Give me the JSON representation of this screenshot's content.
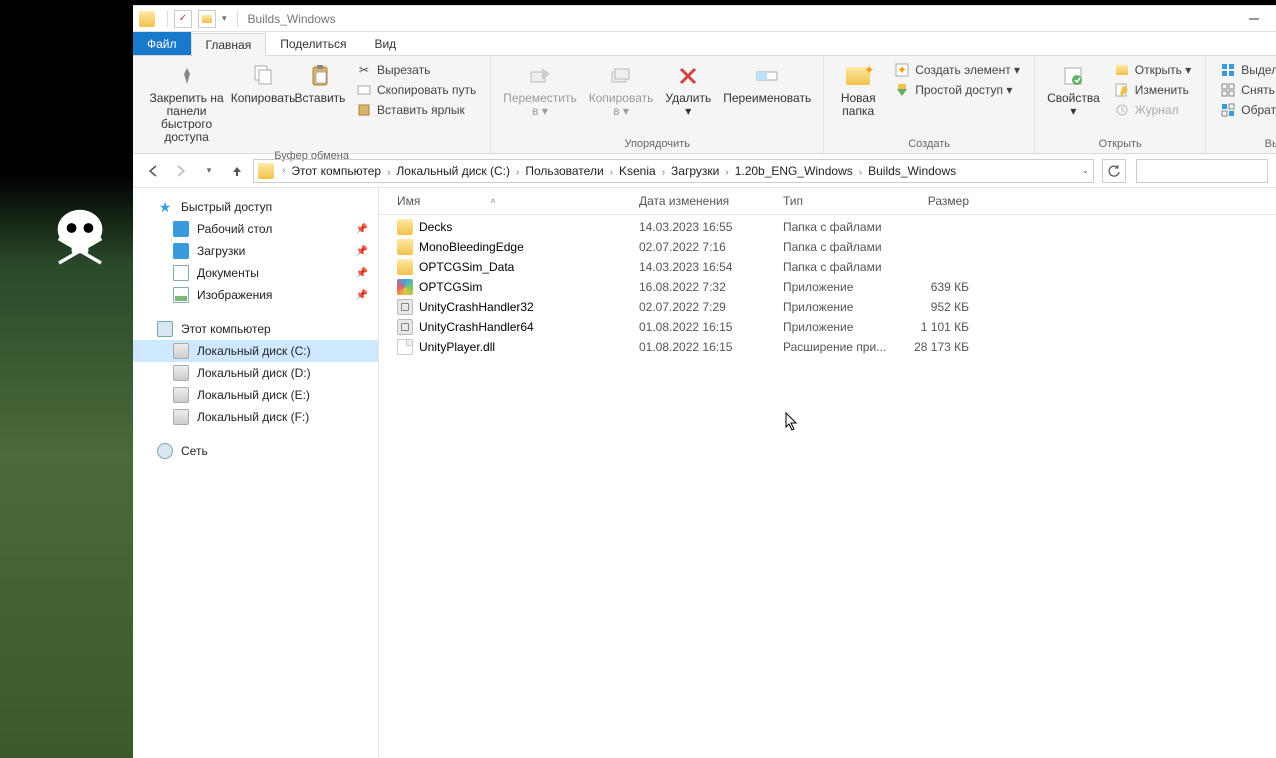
{
  "title": "Builds_Windows",
  "tabs": {
    "file": "Файл",
    "home": "Главная",
    "share": "Поделиться",
    "view": "Вид"
  },
  "ribbon": {
    "clipboard": {
      "label": "Буфер обмена",
      "pin": "Закрепить на панели\nбыстрого доступа",
      "copy": "Копировать",
      "paste": "Вставить",
      "cut": "Вырезать",
      "copypath": "Скопировать путь",
      "pasteshortcut": "Вставить ярлык"
    },
    "organize": {
      "label": "Упорядочить",
      "moveto": "Переместить\nв ▾",
      "copyto": "Копировать\nв ▾",
      "delete": "Удалить\n▾",
      "rename": "Переименовать"
    },
    "new": {
      "label": "Создать",
      "newfolder": "Новая\nпапка",
      "newitem": "Создать элемент ▾",
      "easyaccess": "Простой доступ ▾"
    },
    "open": {
      "label": "Открыть",
      "properties": "Свойства\n▾",
      "open": "Открыть ▾",
      "edit": "Изменить",
      "history": "Журнал"
    },
    "select": {
      "label": "Выделить",
      "selectall": "Выделить все",
      "selectnone": "Снять выделение",
      "invert": "Обратить выделение"
    }
  },
  "breadcrumbs": [
    "Этот компьютер",
    "Локальный диск (C:)",
    "Пользователи",
    "Ksenia",
    "Загрузки",
    "1.20b_ENG_Windows",
    "Builds_Windows"
  ],
  "columns": {
    "name": "Имя",
    "date": "Дата изменения",
    "type": "Тип",
    "size": "Размер"
  },
  "sidebar": {
    "quick": "Быстрый доступ",
    "desktop": "Рабочий стол",
    "downloads": "Загрузки",
    "documents": "Документы",
    "pictures": "Изображения",
    "thispc": "Этот компьютер",
    "drives": [
      "Локальный диск (C:)",
      "Локальный диск (D:)",
      "Локальный диск (E:)",
      "Локальный диск (F:)"
    ],
    "network": "Сеть"
  },
  "files": [
    {
      "icon": "folder",
      "name": "Decks",
      "date": "14.03.2023 16:55",
      "type": "Папка с файлами",
      "size": ""
    },
    {
      "icon": "folder",
      "name": "MonoBleedingEdge",
      "date": "02.07.2022 7:16",
      "type": "Папка с файлами",
      "size": ""
    },
    {
      "icon": "folder",
      "name": "OPTCGSim_Data",
      "date": "14.03.2023 16:54",
      "type": "Папка с файлами",
      "size": ""
    },
    {
      "icon": "app",
      "name": "OPTCGSim",
      "date": "16.08.2022 7:32",
      "type": "Приложение",
      "size": "639 КБ"
    },
    {
      "icon": "exe",
      "name": "UnityCrashHandler32",
      "date": "02.07.2022 7:29",
      "type": "Приложение",
      "size": "952 КБ"
    },
    {
      "icon": "exe",
      "name": "UnityCrashHandler64",
      "date": "01.08.2022 16:15",
      "type": "Приложение",
      "size": "1 101 КБ"
    },
    {
      "icon": "dll",
      "name": "UnityPlayer.dll",
      "date": "01.08.2022 16:15",
      "type": "Расширение при...",
      "size": "28 173 КБ"
    }
  ]
}
